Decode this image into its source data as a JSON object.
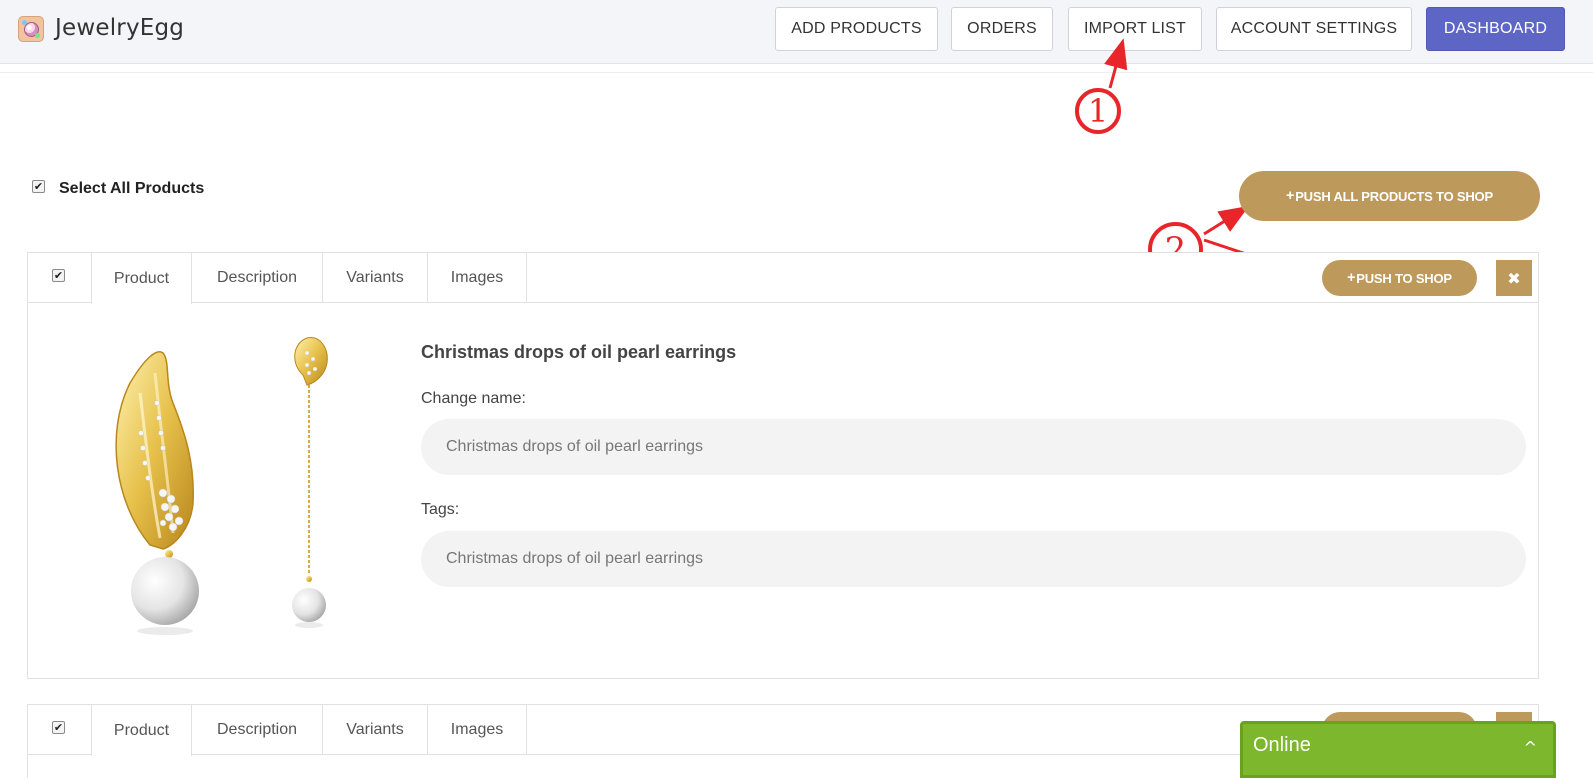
{
  "app": {
    "title": "JewelryEgg",
    "logo_icon": "jewelry-egg-logo-icon"
  },
  "nav": {
    "add_products": "ADD PRODUCTS",
    "orders": "ORDERS",
    "import_list": "IMPORT LIST",
    "account_settings": "ACCOUNT SETTINGS",
    "dashboard": "DASHBOARD"
  },
  "annotations": {
    "step1": "1",
    "step2": "2",
    "color": "#e8262a"
  },
  "select_all": {
    "label": "Select All Products",
    "checked": true
  },
  "actions": {
    "push_all": "PUSH ALL PRODUCTS TO SHOP",
    "push_one": "PUSH TO SHOP",
    "plus_icon": "+",
    "close_icon": "✖"
  },
  "tabs": [
    "Product",
    "Description",
    "Variants",
    "Images"
  ],
  "products": [
    {
      "checked": true,
      "name": "Christmas drops of oil pearl earrings",
      "change_name_label": "Change name:",
      "change_name_value": "Christmas drops of oil pearl earrings",
      "tags_label": "Tags:",
      "tags_value": "Christmas drops of oil pearl earrings"
    },
    {
      "checked": true
    }
  ],
  "chat": {
    "label": "Online",
    "chevron": "^"
  },
  "colors": {
    "gold": "#bd9a5c",
    "primary": "#5d66c4",
    "online_green": "#7cb72d"
  }
}
